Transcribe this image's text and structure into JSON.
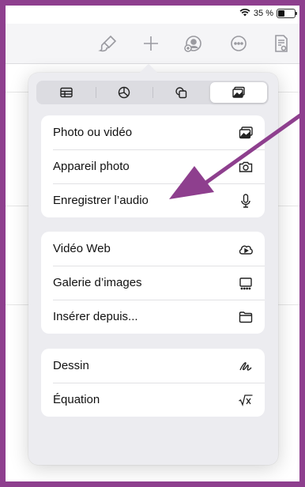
{
  "status": {
    "battery": "35 %"
  },
  "toolbar": {
    "icons": [
      "paintbrush-icon",
      "plus-icon",
      "add-collaborator-icon",
      "more-icon",
      "document-view-icon"
    ]
  },
  "segments": [
    {
      "icon": "table-icon",
      "active": false
    },
    {
      "icon": "chart-icon",
      "active": false
    },
    {
      "icon": "shapes-icon",
      "active": false
    },
    {
      "icon": "media-icon",
      "active": true
    }
  ],
  "menu": {
    "group1": [
      {
        "label": "Photo ou vidéo",
        "icon": "photo-icon"
      },
      {
        "label": "Appareil photo",
        "icon": "camera-icon"
      },
      {
        "label": "Enregistrer l’audio",
        "icon": "microphone-icon"
      }
    ],
    "group2": [
      {
        "label": "Vidéo Web",
        "icon": "cloud-video-icon"
      },
      {
        "label": "Galerie d’images",
        "icon": "gallery-icon"
      },
      {
        "label": "Insérer depuis...",
        "icon": "folder-icon"
      }
    ],
    "group3": [
      {
        "label": "Dessin",
        "icon": "drawing-icon"
      },
      {
        "label": "Équation",
        "icon": "equation-icon"
      }
    ]
  },
  "colors": {
    "frame": "#8e3f8e",
    "arrow": "#8e3f8e",
    "icon_gray": "#9a9aa0"
  }
}
